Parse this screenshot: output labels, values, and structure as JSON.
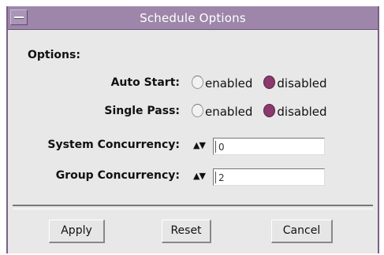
{
  "window": {
    "title": "Schedule Options"
  },
  "options": {
    "section_label": "Options:",
    "auto_start": {
      "label": "Auto Start:",
      "option_enabled": "enabled",
      "option_disabled": "disabled",
      "selected": "disabled"
    },
    "single_pass": {
      "label": "Single Pass:",
      "option_enabled": "enabled",
      "option_disabled": "disabled",
      "selected": "disabled"
    },
    "system_concurrency": {
      "label": "System Concurrency:",
      "value": "0"
    },
    "group_concurrency": {
      "label": "Group Concurrency:",
      "value": "2"
    },
    "spinner_arrows": "▲▼"
  },
  "buttons": {
    "apply": "Apply",
    "reset": "Reset",
    "cancel": "Cancel"
  },
  "colors": {
    "titlebar": "#9d86aa",
    "radio_selected": "#8a3a6e",
    "background": "#e8e8e8"
  }
}
